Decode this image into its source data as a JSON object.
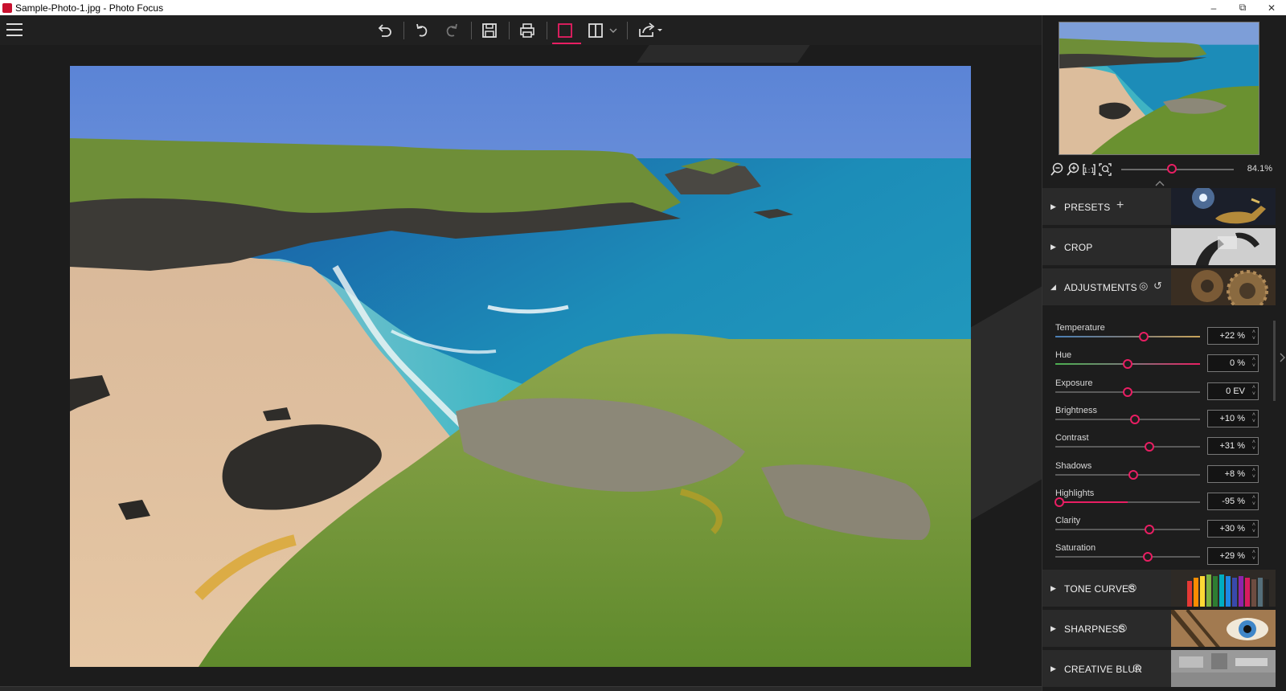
{
  "window": {
    "title": "Sample-Photo-1.jpg - Photo Focus",
    "minimize": "–",
    "maximize": "⧉",
    "close": "✕"
  },
  "toolbar": {
    "menu_icon": "hamburger-icon",
    "buttons": [
      "undo-all-icon",
      "undo-icon",
      "redo-icon",
      "save-icon",
      "print-icon",
      "single-view-icon",
      "split-view-icon",
      "split-view-dropdown-icon",
      "share-icon"
    ],
    "active_button": "single-view-icon",
    "accent_color": "#e91e63"
  },
  "navigator": {
    "zoom_value": "84.1%",
    "zoom_level_fraction": 0.45,
    "zoom_buttons": [
      "zoom-out-icon",
      "zoom-in-icon",
      "actual-size-icon",
      "fit-to-window-icon"
    ]
  },
  "panel": {
    "sections": [
      {
        "id": "presets",
        "label": "PRESETS",
        "expanded": false,
        "extra": "+"
      },
      {
        "id": "crop",
        "label": "CROP",
        "expanded": false
      },
      {
        "id": "adjustments",
        "label": "ADJUSTMENTS",
        "expanded": true
      },
      {
        "id": "tone_curves",
        "label": "TONE CURVES",
        "expanded": false
      },
      {
        "id": "sharpness",
        "label": "SHARPNESS",
        "expanded": false
      },
      {
        "id": "creative_blur",
        "label": "CREATIVE BLUR",
        "expanded": false
      }
    ],
    "arrow_collapsed": "▶",
    "arrow_expanded": "◢",
    "eye_icon": "◎",
    "reset_icon": "↺"
  },
  "adjustments": [
    {
      "name": "Temperature",
      "value": "+22 %",
      "level": 0.61
    },
    {
      "name": "Hue",
      "value": "0 %",
      "level": 0.5
    },
    {
      "name": "Exposure",
      "value": "0 EV",
      "level": 0.5
    },
    {
      "name": "Brightness",
      "value": "+10 %",
      "level": 0.55
    },
    {
      "name": "Contrast",
      "value": "+31 %",
      "level": 0.65
    },
    {
      "name": "Shadows",
      "value": "+8 %",
      "level": 0.54
    },
    {
      "name": "Highlights",
      "value": "-95 %",
      "level": 0.03
    },
    {
      "name": "Clarity",
      "value": "+30 %",
      "level": 0.65
    },
    {
      "name": "Saturation",
      "value": "+29 %",
      "level": 0.64
    }
  ],
  "spinner": {
    "up": "˄",
    "down": "˅"
  }
}
